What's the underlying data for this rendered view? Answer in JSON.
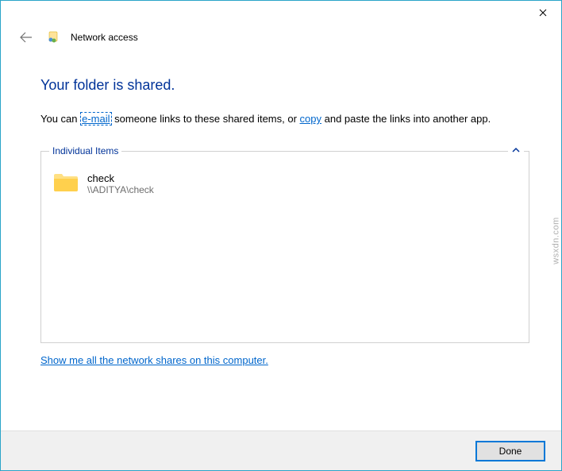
{
  "window": {
    "title": "Network access"
  },
  "main": {
    "heading": "Your folder is shared.",
    "desc_prefix": "You can ",
    "email_link": "e-mail",
    "desc_mid": " someone links to these shared items, or ",
    "copy_link": "copy",
    "desc_suffix": " and paste the links into another app."
  },
  "group": {
    "legend": "Individual Items",
    "items": [
      {
        "name": "check",
        "path": "\\\\ADITYA\\check"
      }
    ]
  },
  "shares_link": "Show me all the network shares on this computer.",
  "footer": {
    "done": "Done"
  },
  "watermark": "wsxdn.com"
}
